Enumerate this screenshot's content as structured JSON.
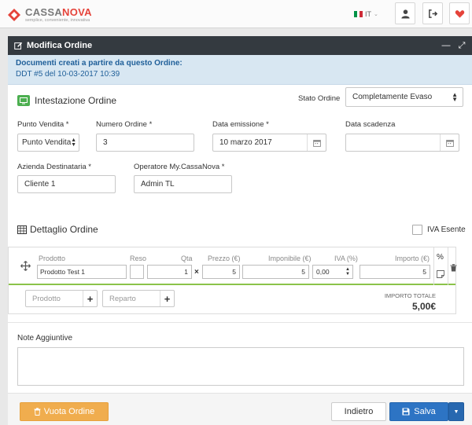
{
  "brand": {
    "name_a": "CASSA",
    "name_b": "NOVA",
    "tagline": "semplice, conveniente, innovativa"
  },
  "topbar": {
    "lang": "IT"
  },
  "colors": {
    "accent_red": "#e5433a",
    "header_dark": "#343a40",
    "info_bg": "#d8e7f2",
    "green": "#4caf50",
    "primary": "#2d74c4",
    "warning": "#f0ad4e"
  },
  "panel": {
    "title": "Modifica Ordine",
    "info_title": "Documenti creati a partire da questo Ordine:",
    "info_link": "DDT #5 del 10-03-2017 10:39"
  },
  "header_section": {
    "title": "Intestazione Ordine",
    "stato_label": "Stato Ordine",
    "stato_value": "Completamente Evaso",
    "punto_vendita_label": "Punto Vendita *",
    "punto_vendita_value": "Punto Vendita",
    "numero_label": "Numero Ordine *",
    "numero_value": "3",
    "data_emissione_label": "Data emissione *",
    "data_emissione_value": "10 marzo 2017",
    "data_scadenza_label": "Data scadenza",
    "data_scadenza_value": "",
    "azienda_label": "Azienda Destinataria *",
    "azienda_value": "Cliente 1",
    "operatore_label": "Operatore My.CassaNova *",
    "operatore_value": "Admin TL"
  },
  "detail": {
    "title": "Dettaglio Ordine",
    "iva_esente": "IVA Esente",
    "columns": {
      "prodotto": "Prodotto",
      "reso": "Reso",
      "qta": "Qta",
      "prezzo": "Prezzo (€)",
      "imponibile": "Imponibile (€)",
      "iva": "IVA (%)",
      "importo": "Importo (€)",
      "pct": "%"
    },
    "row": {
      "prodotto": "Prodotto Test 1",
      "qta": "1",
      "x": "×",
      "prezzo": "5",
      "imponibile": "5",
      "iva": "0,00",
      "importo": "5"
    },
    "add_prodotto": "Prodotto",
    "add_reparto": "Reparto",
    "total_label": "IMPORTO TOTALE",
    "total_value": "5,00€"
  },
  "notes": {
    "label": "Note Aggiuntive",
    "value": ""
  },
  "footer": {
    "vuota": "Vuota Ordine",
    "indietro": "Indietro",
    "salva": "Salva"
  }
}
